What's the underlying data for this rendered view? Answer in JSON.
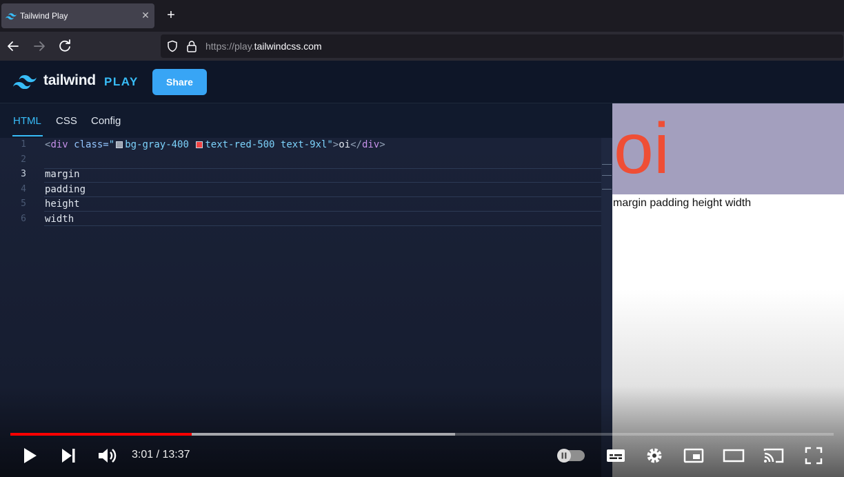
{
  "browser": {
    "tab_title": "Tailwind Play",
    "url_prefix": "https://play.",
    "url_domain": "tailwindcss.com"
  },
  "header": {
    "brand_word": "tailwind",
    "brand_play": "PLAY",
    "share_label": "Share"
  },
  "editor": {
    "tabs": [
      {
        "label": "HTML",
        "active": true
      },
      {
        "label": "CSS",
        "active": false
      },
      {
        "label": "Config",
        "active": false
      }
    ],
    "lines": [
      {
        "n": "1",
        "text": ""
      },
      {
        "n": "2",
        "text": ""
      },
      {
        "n": "3",
        "text": "margin"
      },
      {
        "n": "4",
        "text": "padding"
      },
      {
        "n": "5",
        "text": "height"
      },
      {
        "n": "6",
        "text": "width"
      }
    ],
    "line1": {
      "open_lt": "<",
      "tag": "div",
      "attr": " class=",
      "quote_open": "\"",
      "class_1": "bg-gray-400",
      "class_2": "text-red-500",
      "class_3": " text-9xl",
      "quote_close": "\"",
      "gt": ">",
      "content": "oi",
      "close_lt": "</",
      "close_tag": "div",
      "close_gt": ">",
      "swatch_1_color": "#9ca3af",
      "swatch_2_color": "#ef4444"
    },
    "current_line": "3"
  },
  "preview": {
    "big_text": "oi",
    "body_text": "margin padding height width",
    "box_color": "#a39fbe",
    "text_color": "#ef4e35"
  },
  "player": {
    "time": "3:01 / 13:37",
    "played_fraction": 0.22,
    "buffered_fraction": 0.54,
    "icons": [
      "play-icon",
      "next-icon",
      "volume-icon",
      "autoplay-toggle",
      "subtitles-icon",
      "settings-icon",
      "miniplayer-icon",
      "theater-icon",
      "cast-icon",
      "fullscreen-icon"
    ]
  }
}
